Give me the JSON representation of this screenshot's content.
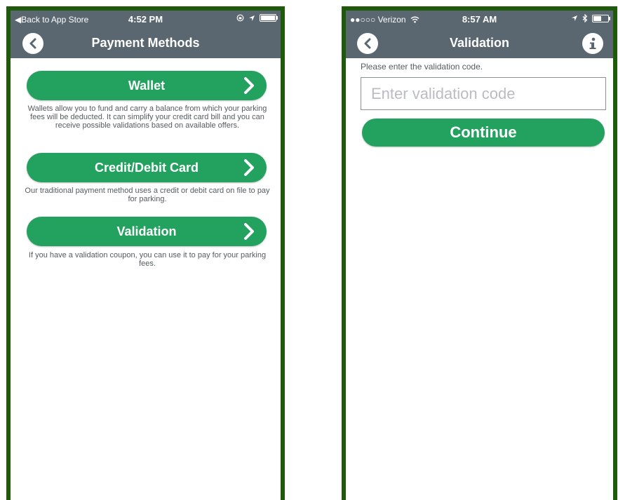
{
  "left_screen": {
    "status_bar": {
      "back_to_app": "◀Back to App Store",
      "time": "4:52 PM"
    },
    "nav_title": "Payment Methods",
    "options": [
      {
        "label": "Wallet",
        "description": "Wallets allow you to fund and carry a balance from which your parking fees will be deducted. It can simplify your credit card bill and you can receive possible validations based on available offers."
      },
      {
        "label": "Credit/Debit Card",
        "description": "Our traditional payment method uses a credit or debit card on file to pay for parking."
      },
      {
        "label": "Validation",
        "description": "If you have a validation coupon, you can use it to pay for your parking fees."
      }
    ]
  },
  "right_screen": {
    "status_bar": {
      "carrier": "●●○○○ Verizon",
      "time": "8:57 AM",
      "battery_level": 0.5
    },
    "nav_title": "Validation",
    "prompt": "Please enter the validation code.",
    "input_value": "",
    "input_placeholder": "Enter validation code",
    "continue_label": "Continue"
  },
  "colors": {
    "navbar": "#5b6770",
    "accent_green": "#23a25f",
    "frame": "#1f5a0a"
  },
  "icons": {
    "back": "chevron-left-circle-icon",
    "info": "info-circle-icon",
    "option_arrow": "chevron-right-icon",
    "wifi": "wifi-icon",
    "location": "location-arrow-icon",
    "bluetooth": "bluetooth-icon",
    "battery": "battery-icon",
    "orientation_lock": "orientation-lock-icon"
  }
}
